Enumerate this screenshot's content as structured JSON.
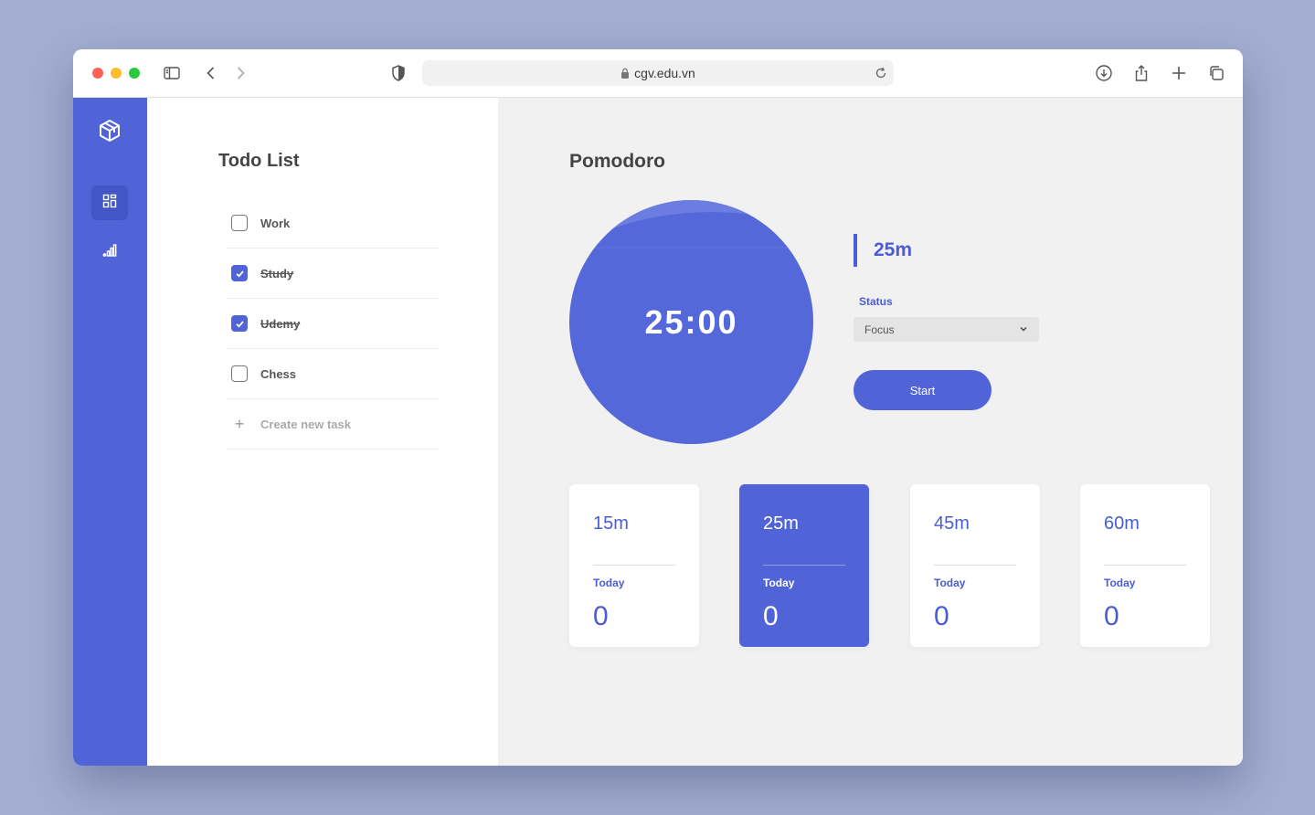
{
  "browser": {
    "url": "cgv.edu.vn"
  },
  "todo": {
    "title": "Todo List",
    "items": [
      {
        "label": "Work",
        "done": false
      },
      {
        "label": "Study",
        "done": true
      },
      {
        "label": "Udemy",
        "done": true
      },
      {
        "label": "Chess",
        "done": false
      }
    ],
    "new_task_label": "Create new task"
  },
  "pomodoro": {
    "title": "Pomodoro",
    "timer": "25:00",
    "current_duration": "25m",
    "status_label": "Status",
    "status_value": "Focus",
    "start_label": "Start",
    "cards": [
      {
        "duration": "15m",
        "today_label": "Today",
        "count": "0",
        "active": false
      },
      {
        "duration": "25m",
        "today_label": "Today",
        "count": "0",
        "active": true
      },
      {
        "duration": "45m",
        "today_label": "Today",
        "count": "0",
        "active": false
      },
      {
        "duration": "60m",
        "today_label": "Today",
        "count": "0",
        "active": false
      }
    ]
  },
  "colors": {
    "brand": "#5064d8",
    "page_background": "#a3aed0",
    "panel_background": "#f1f1f1"
  },
  "icons": {
    "sidebar_logo": "cube-icon",
    "sidebar_dashboard": "dashboard-grid-icon",
    "sidebar_stats": "bar-chart-icon"
  }
}
